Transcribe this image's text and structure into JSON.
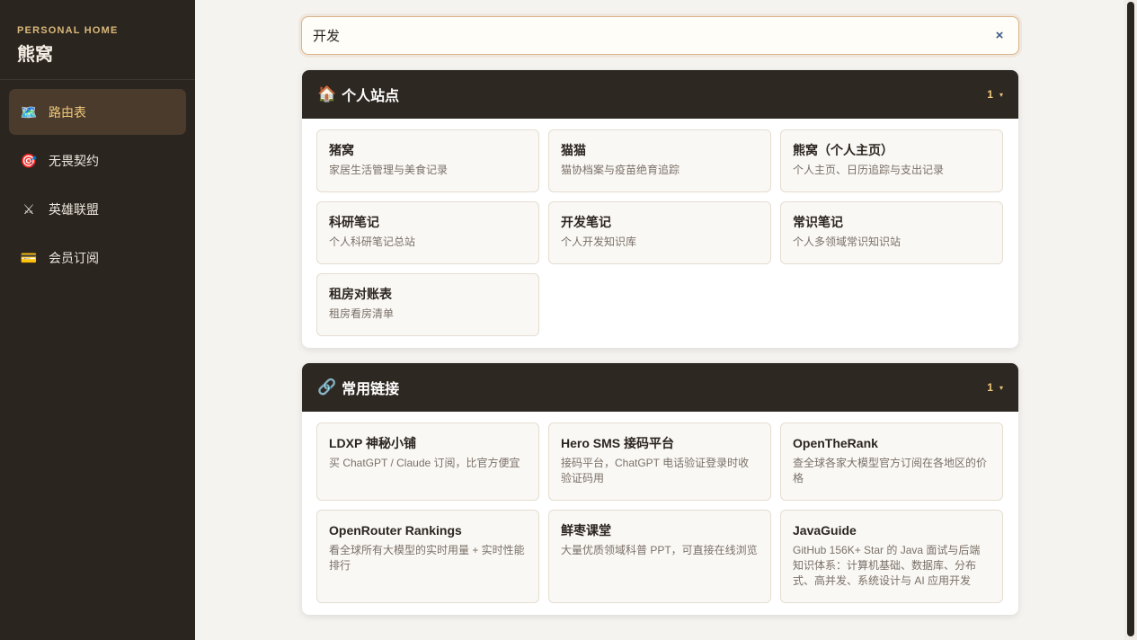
{
  "sidebar": {
    "brand_sub": "PERSONAL HOME",
    "brand_title": "熊窝",
    "items": [
      {
        "icon": "🗺️",
        "icon_name": "map-icon",
        "label": "路由表",
        "active": true
      },
      {
        "icon": "🎯",
        "icon_name": "target-icon",
        "label": "无畏契约",
        "active": false
      },
      {
        "icon": "⚔",
        "icon_name": "crossed-swords-icon",
        "label": "英雄联盟",
        "active": false
      },
      {
        "icon": "💳",
        "icon_name": "credit-card-icon",
        "label": "会员订阅",
        "active": false
      }
    ]
  },
  "search": {
    "value": "开发",
    "clear_icon": "×"
  },
  "sections": [
    {
      "icon": "🏠",
      "icon_name": "house-icon",
      "title": "个人站点",
      "count": "1",
      "caret": "▾",
      "cards": [
        {
          "title": "猪窝",
          "desc": "家居生活管理与美食记录"
        },
        {
          "title": "猫猫",
          "desc": "猫协档案与疫苗绝育追踪"
        },
        {
          "title": "熊窝（个人主页）",
          "desc": "个人主页、日历追踪与支出记录"
        },
        {
          "title": "科研笔记",
          "desc": "个人科研笔记总站"
        },
        {
          "title": "开发笔记",
          "desc": "个人开发知识库"
        },
        {
          "title": "常识笔记",
          "desc": "个人多领域常识知识站"
        },
        {
          "title": "租房对账表",
          "desc": "租房看房清单"
        }
      ]
    },
    {
      "icon": "🔗",
      "icon_name": "link-icon",
      "title": "常用链接",
      "count": "1",
      "caret": "▾",
      "cards": [
        {
          "title": "LDXP 神秘小铺",
          "desc": "买 ChatGPT / Claude 订阅，比官方便宜"
        },
        {
          "title": "Hero SMS 接码平台",
          "desc": "接码平台，ChatGPT 电话验证登录时收验证码用"
        },
        {
          "title": "OpenTheRank",
          "desc": "查全球各家大模型官方订阅在各地区的价格"
        },
        {
          "title": "OpenRouter Rankings",
          "desc": "看全球所有大模型的实时用量 + 实时性能排行"
        },
        {
          "title": "鲜枣课堂",
          "desc": "大量优质领域科普 PPT，可直接在线浏览"
        },
        {
          "title": "JavaGuide",
          "desc": "GitHub 156K+ Star 的 Java 面试与后端知识体系：计算机基础、数据库、分布式、高并发、系统设计与 AI 应用开发"
        }
      ]
    }
  ]
}
